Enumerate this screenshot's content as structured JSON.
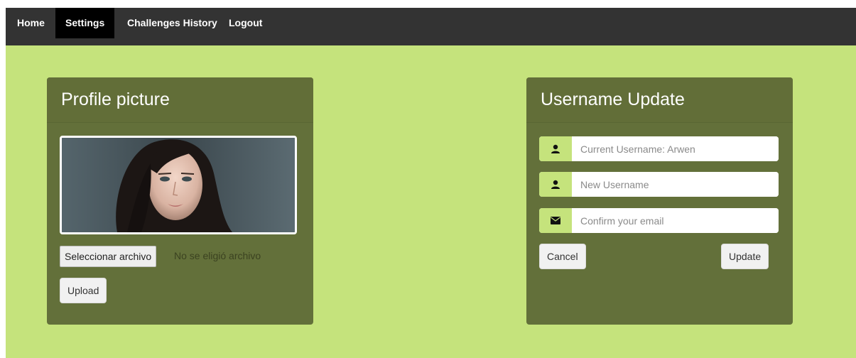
{
  "nav": {
    "items": [
      {
        "label": "Home"
      },
      {
        "label": "Settings"
      },
      {
        "label": "Challenges History"
      },
      {
        "label": "Logout"
      }
    ]
  },
  "profile_panel": {
    "title": "Profile picture",
    "choose_file_label": "Seleccionar archivo",
    "file_status": "No se eligió archivo",
    "upload_label": "Upload"
  },
  "username_panel": {
    "title": "Username Update",
    "current_placeholder": "Current Username: Arwen",
    "new_placeholder": "New Username",
    "confirm_placeholder": "Confirm your email",
    "cancel_label": "Cancel",
    "update_label": "Update"
  },
  "colors": {
    "page_bg": "#c5e37c",
    "navbar_bg": "#333333",
    "panel_bg": "#63703a"
  }
}
